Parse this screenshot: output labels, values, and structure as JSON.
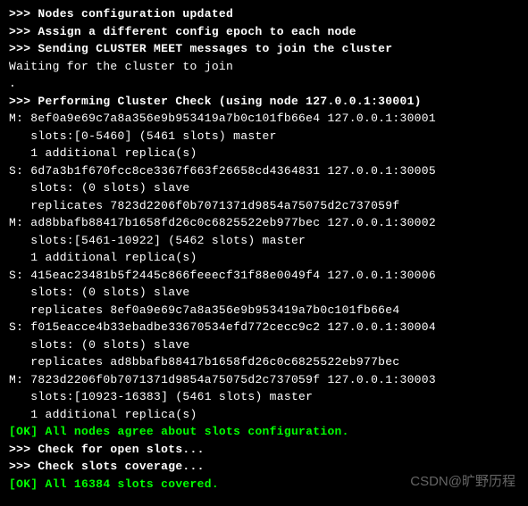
{
  "lines": {
    "l1": ">>> Nodes configuration updated",
    "l2": ">>> Assign a different config epoch to each node",
    "l3": ">>> Sending CLUSTER MEET messages to join the cluster",
    "l4": "Waiting for the cluster to join",
    "l5": ".",
    "l6": ">>> Performing Cluster Check (using node 127.0.0.1:30001)",
    "l7": "M: 8ef0a9e69c7a8a356e9b953419a7b0c101fb66e4 127.0.0.1:30001",
    "l8": "   slots:[0-5460] (5461 slots) master",
    "l9": "   1 additional replica(s)",
    "l10": "S: 6d7a3b1f670fcc8ce3367f663f26658cd4364831 127.0.0.1:30005",
    "l11": "   slots: (0 slots) slave",
    "l12": "   replicates 7823d2206f0b7071371d9854a75075d2c737059f",
    "l13": "M: ad8bbafb88417b1658fd26c0c6825522eb977bec 127.0.0.1:30002",
    "l14": "   slots:[5461-10922] (5462 slots) master",
    "l15": "   1 additional replica(s)",
    "l16": "S: 415eac23481b5f2445c866feeecf31f88e0049f4 127.0.0.1:30006",
    "l17": "   slots: (0 slots) slave",
    "l18": "   replicates 8ef0a9e69c7a8a356e9b953419a7b0c101fb66e4",
    "l19": "S: f015eacce4b33ebadbe33670534efd772cecc9c2 127.0.0.1:30004",
    "l20": "   slots: (0 slots) slave",
    "l21": "   replicates ad8bbafb88417b1658fd26c0c6825522eb977bec",
    "l22": "M: 7823d2206f0b7071371d9854a75075d2c737059f 127.0.0.1:30003",
    "l23": "   slots:[10923-16383] (5461 slots) master",
    "l24": "   1 additional replica(s)",
    "l25": "[OK] All nodes agree about slots configuration.",
    "l26": ">>> Check for open slots...",
    "l27": ">>> Check slots coverage...",
    "l28": "[OK] All 16384 slots covered."
  },
  "watermark": "CSDN@旷野历程"
}
